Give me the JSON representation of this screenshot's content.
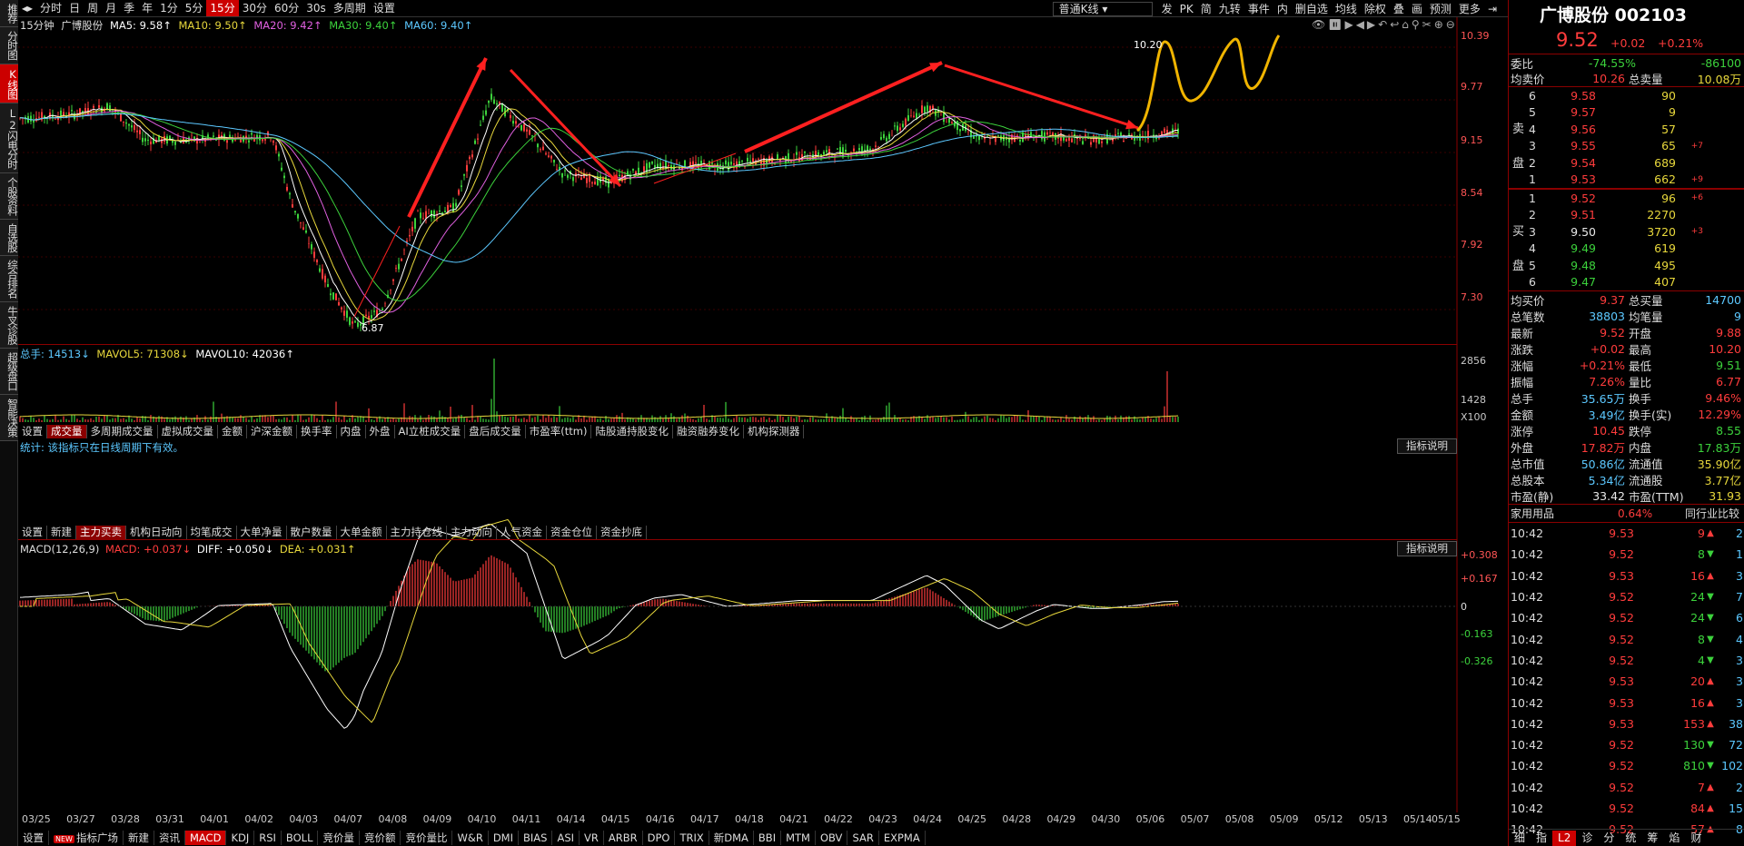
{
  "sidebar": [
    "推荐",
    "分时图",
    "K线图",
    "L2闪电分时",
    "个股资料",
    "自选股",
    "综合排名",
    "牛叉诊股",
    "超级盘口",
    "智能决策"
  ],
  "toolbar": {
    "items": [
      "分时",
      "日",
      "周",
      "月",
      "季",
      "年",
      "1分",
      "5分",
      "15分",
      "30分",
      "60分",
      "30s",
      "多周期",
      "设置"
    ],
    "active": "15分",
    "chart_type": "普通K线",
    "right_items": [
      "发",
      "PK",
      "简",
      "九转",
      "事件",
      "内",
      "删自选",
      "均线",
      "除权",
      "叠",
      "画",
      "预测",
      "更多"
    ]
  },
  "kline": {
    "title": "15分钟",
    "stock": "广博股份",
    "ma5": "MA5: 9.58↑",
    "ma10": "MA10: 9.50↑",
    "ma20": "MA20: 9.42↑",
    "ma30": "MA30: 9.40↑",
    "ma60": "MA60: 9.40↑",
    "price_axis": [
      "10.39",
      "9.77",
      "9.15",
      "8.54",
      "7.92",
      "7.30"
    ],
    "high_label": "10.20",
    "low_label": "6.87"
  },
  "volume": {
    "total": "总手: 14513↓",
    "mavol5": "MAVOL5: 71308↓",
    "mavol10": "MAVOL10: 42036↑",
    "axis": [
      "2856",
      "1428",
      "X100"
    ]
  },
  "volume_tabs": [
    "设置",
    "成交量",
    "多周期成交量",
    "虚拟成交量",
    "金额",
    "沪深金额",
    "换手率",
    "内盘",
    "外盘",
    "AI立桩成交量",
    "盘后成交量",
    "市盈率(ttm)",
    "陆股通持股变化",
    "融资融券变化",
    "机构探测器"
  ],
  "volume_tab_active": "成交量",
  "stat": {
    "message": "统计: 该指标只在日线周期下有效。",
    "explain": "指标说明"
  },
  "fund_tabs": [
    "设置",
    "新建",
    "主力买卖",
    "机构日动向",
    "均笔成交",
    "大单净量",
    "散户数量",
    "大单金额",
    "主力持仓线",
    "主力动向",
    "人气资金",
    "资金仓位",
    "资金抄底"
  ],
  "fund_tab_active": "主力买卖",
  "macd": {
    "title": "MACD(12,26,9)",
    "macd": "MACD: +0.037↓",
    "diff": "DIFF: +0.050↓",
    "dea": "DEA: +0.031↑",
    "explain": "指标说明",
    "axis": [
      "+0.308",
      "+0.167",
      "0",
      "-0.163",
      "-0.326"
    ]
  },
  "dates": [
    "03/25",
    "03/27",
    "03/28",
    "03/31",
    "04/01",
    "04/02",
    "04/03",
    "04/07",
    "04/08",
    "04/09",
    "04/10",
    "04/11",
    "04/14",
    "04/15",
    "04/16",
    "04/17",
    "04/18",
    "04/21",
    "04/22",
    "04/23",
    "04/24",
    "04/25",
    "04/28",
    "04/29",
    "04/30",
    "05/06",
    "05/07",
    "05/08",
    "05/09",
    "05/12",
    "05/13",
    "05/14",
    "05/15"
  ],
  "bottom_tabs": [
    "设置",
    "指标广场",
    "新建",
    "资讯",
    "MACD",
    "KDJ",
    "RSI",
    "BOLL",
    "竞价量",
    "竞价额",
    "竞价量比",
    "W&R",
    "DMI",
    "BIAS",
    "ASI",
    "VR",
    "ARBR",
    "DPO",
    "TRIX",
    "新DMA",
    "BBI",
    "MTM",
    "OBV",
    "SAR",
    "EXPMA"
  ],
  "bottom_tab_active": "MACD",
  "new_badge": "NEW",
  "quote": {
    "name": "广博股份 002103",
    "price": "9.52",
    "change": "+0.02",
    "pct": "+0.21%",
    "webi_label": "委比",
    "webi": "-74.55%",
    "weicha": "-86100",
    "avg_sell_label": "均卖价",
    "avg_sell": "10.26",
    "total_sell_label": "总卖量",
    "total_sell": "10.08万"
  },
  "asks": [
    {
      "lvl": "6",
      "price": "9.58",
      "vol": "90",
      "chg": ""
    },
    {
      "lvl": "5",
      "price": "9.57",
      "vol": "9",
      "chg": ""
    },
    {
      "lvl": "4",
      "price": "9.56",
      "vol": "57",
      "chg": ""
    },
    {
      "lvl": "3",
      "price": "9.55",
      "vol": "65",
      "chg": "+7"
    },
    {
      "lvl": "2",
      "price": "9.54",
      "vol": "689",
      "chg": ""
    },
    {
      "lvl": "1",
      "price": "9.53",
      "vol": "662",
      "chg": "+9"
    }
  ],
  "sell_label": "卖盘",
  "bids": [
    {
      "lvl": "1",
      "price": "9.52",
      "vol": "96",
      "chg": "+6"
    },
    {
      "lvl": "2",
      "price": "9.51",
      "vol": "2270",
      "chg": ""
    },
    {
      "lvl": "3",
      "price": "9.50",
      "vol": "3720",
      "chg": "+3"
    },
    {
      "lvl": "4",
      "price": "9.49",
      "vol": "619",
      "chg": ""
    },
    {
      "lvl": "5",
      "price": "9.48",
      "vol": "495",
      "chg": ""
    },
    {
      "lvl": "6",
      "price": "9.47",
      "vol": "407",
      "chg": ""
    }
  ],
  "buy_label": "买盘",
  "stats": [
    {
      "k1": "均买价",
      "v1": "9.37",
      "k2": "总买量",
      "v2": "14700"
    },
    {
      "k1": "总笔数",
      "v1": "38803",
      "k2": "均笔量",
      "v2": "9"
    },
    {
      "k1": "最新",
      "v1": "9.52",
      "k2": "开盘",
      "v2": "9.88"
    },
    {
      "k1": "涨跌",
      "v1": "+0.02",
      "k2": "最高",
      "v2": "10.20"
    },
    {
      "k1": "涨幅",
      "v1": "+0.21%",
      "k2": "最低",
      "v2": "9.51"
    },
    {
      "k1": "振幅",
      "v1": "7.26%",
      "k2": "量比",
      "v2": "6.77"
    },
    {
      "k1": "总手",
      "v1": "35.65万",
      "k2": "换手",
      "v2": "9.46%"
    },
    {
      "k1": "金额",
      "v1": "3.49亿",
      "k2": "换手(实)",
      "v2": "12.29%"
    },
    {
      "k1": "涨停",
      "v1": "10.45",
      "k2": "跌停",
      "v2": "8.55"
    },
    {
      "k1": "外盘",
      "v1": "17.82万",
      "k2": "内盘",
      "v2": "17.83万"
    },
    {
      "k1": "总市值",
      "v1": "50.86亿",
      "k2": "流通值",
      "v2": "35.90亿"
    },
    {
      "k1": "总股本",
      "v1": "5.34亿",
      "k2": "流通股",
      "v2": "3.77亿"
    },
    {
      "k1": "市盈(静)",
      "v1": "33.42",
      "k2": "市盈(TTM)",
      "v2": "31.93"
    }
  ],
  "industry": {
    "name": "家用用品",
    "pct": "0.64%",
    "compare": "同行业比较"
  },
  "ticks": [
    {
      "t": "10:42",
      "p": "9.53",
      "v": "9",
      "d": "up",
      "n": "2"
    },
    {
      "t": "10:42",
      "p": "9.52",
      "v": "8",
      "d": "down",
      "n": "1"
    },
    {
      "t": "10:42",
      "p": "9.53",
      "v": "16",
      "d": "up",
      "n": "3"
    },
    {
      "t": "10:42",
      "p": "9.52",
      "v": "24",
      "d": "down",
      "n": "7"
    },
    {
      "t": "10:42",
      "p": "9.52",
      "v": "24",
      "d": "down",
      "n": "6"
    },
    {
      "t": "10:42",
      "p": "9.52",
      "v": "8",
      "d": "down",
      "n": "4"
    },
    {
      "t": "10:42",
      "p": "9.52",
      "v": "4",
      "d": "down",
      "n": "3"
    },
    {
      "t": "10:42",
      "p": "9.53",
      "v": "20",
      "d": "up",
      "n": "3"
    },
    {
      "t": "10:42",
      "p": "9.53",
      "v": "16",
      "d": "up",
      "n": "3"
    },
    {
      "t": "10:42",
      "p": "9.53",
      "v": "153",
      "d": "up",
      "n": "38"
    },
    {
      "t": "10:42",
      "p": "9.52",
      "v": "130",
      "d": "down",
      "n": "72"
    },
    {
      "t": "10:42",
      "p": "9.52",
      "v": "810",
      "d": "down",
      "n": "102"
    },
    {
      "t": "10:42",
      "p": "9.52",
      "v": "7",
      "d": "up",
      "n": "2"
    },
    {
      "t": "10:42",
      "p": "9.52",
      "v": "84",
      "d": "up",
      "n": "15"
    },
    {
      "t": "10:42",
      "p": "9.52",
      "v": "57",
      "d": "up",
      "n": "8"
    }
  ],
  "rp_bottom": [
    "细",
    "指",
    "L2",
    "诊",
    "分",
    "统",
    "筹",
    "焰",
    "财"
  ],
  "rp_bottom_active": "L2",
  "colors": {
    "up": "#ff3c3c",
    "down": "#3cd23c",
    "ma5": "#ffffff",
    "ma10": "#e8d83c",
    "ma20": "#e060e0",
    "ma30": "#3cd23c",
    "ma60": "#5cc8ff",
    "border": "#8b0000"
  }
}
